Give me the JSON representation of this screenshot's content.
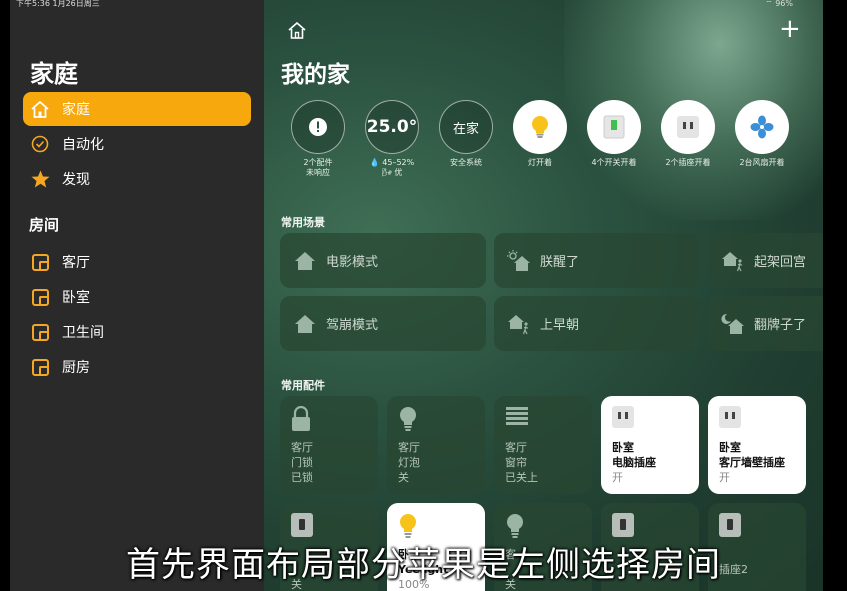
{
  "status_bar": {
    "time": "下午5:36   1月26日周三",
    "battery": "96%"
  },
  "sidebar": {
    "title": "家庭",
    "items": [
      {
        "label": "家庭",
        "icon": "house-icon",
        "active": true
      },
      {
        "label": "自动化",
        "icon": "clock-check-icon"
      },
      {
        "label": "发现",
        "icon": "star-icon"
      }
    ],
    "rooms_title": "房间",
    "rooms": [
      {
        "label": "客厅"
      },
      {
        "label": "卧室"
      },
      {
        "label": "卫生间"
      },
      {
        "label": "厨房"
      }
    ]
  },
  "main": {
    "title": "我的家",
    "status_items": [
      {
        "value": "!",
        "caption1": "2个配件",
        "caption2": "未响应",
        "icon": "alert-icon"
      },
      {
        "value": "25.0°",
        "caption1": "💧 45–52%",
        "caption2": "🌬 优",
        "icon": "thermometer"
      },
      {
        "value": "在家",
        "caption1": "安全系统",
        "caption2": "",
        "icon": "security"
      },
      {
        "value": "",
        "caption1": "灯开着",
        "caption2": "",
        "icon": "bulb-icon"
      },
      {
        "value": "",
        "caption1": "4个开关开着",
        "caption2": "",
        "icon": "switch-icon"
      },
      {
        "value": "",
        "caption1": "2个插座开着",
        "caption2": "",
        "icon": "outlet-icon"
      },
      {
        "value": "",
        "caption1": "2台风扇开着",
        "caption2": "",
        "icon": "fan-icon"
      }
    ],
    "scenes_title": "常用场景",
    "scenes": [
      {
        "label": "电影模式",
        "icon": "house-icon"
      },
      {
        "label": "朕醒了",
        "icon": "sunrise-house-icon"
      },
      {
        "label": "起架回宫",
        "icon": "person-house-icon"
      },
      {
        "label": "驾崩模式",
        "icon": "house-icon"
      },
      {
        "label": "上早朝",
        "icon": "person-house-icon"
      },
      {
        "label": "翻牌子了",
        "icon": "moon-house-icon"
      }
    ],
    "accessories_title": "常用配件",
    "accessories": [
      {
        "room": "客厅",
        "name": "门锁",
        "state": "已锁",
        "icon": "lock-icon",
        "on": false
      },
      {
        "room": "客厅",
        "name": "灯泡",
        "state": "关",
        "icon": "bulb-icon",
        "on": false
      },
      {
        "room": "客厅",
        "name": "窗帘",
        "state": "已关上",
        "icon": "blinds-icon",
        "on": false
      },
      {
        "room": "卧室",
        "name": "电脑插座",
        "state": "开",
        "icon": "outlet-icon",
        "on": true
      },
      {
        "room": "卧室",
        "name": "客厅墙壁插座",
        "state": "开",
        "icon": "outlet-icon",
        "on": true
      },
      {
        "room": "",
        "name": "",
        "state": "关",
        "icon": "switch-icon",
        "on": false
      },
      {
        "room": "卧",
        "name": "Yeelight",
        "state": "100%",
        "icon": "bulb-icon",
        "on": true
      },
      {
        "room": "客",
        "name": "",
        "state": "关",
        "icon": "bulb-icon",
        "on": false
      },
      {
        "room": "",
        "name": "",
        "state": "",
        "icon": "switch-icon",
        "on": false
      },
      {
        "room": "",
        "name": "插座2",
        "state": "",
        "icon": "switch-icon",
        "on": false
      }
    ]
  },
  "caption": "首先界面布局部分苹果是左侧选择房间",
  "colors": {
    "accent": "#f7a80c",
    "sidebar_bg": "#2a2a2a",
    "tile_dark": "#2c4a38"
  }
}
